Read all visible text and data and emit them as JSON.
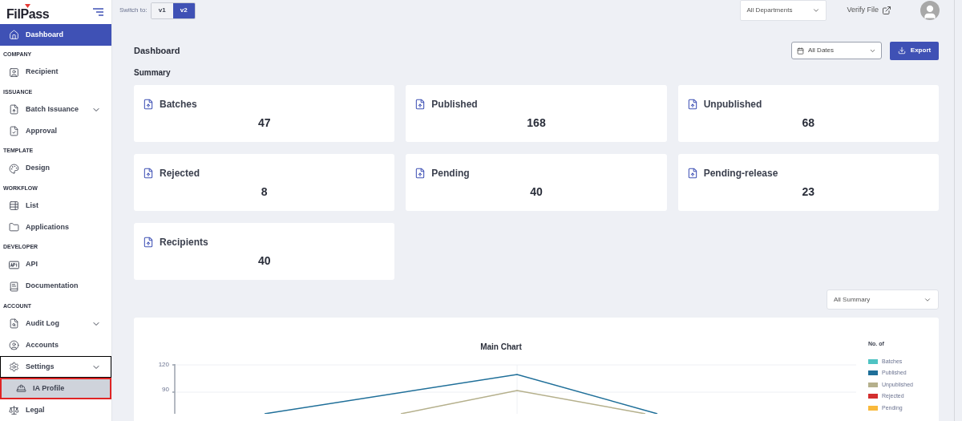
{
  "logo": "FilPass",
  "sidebar": {
    "sections": [
      {
        "items": [
          {
            "label": "Dashboard",
            "selected": true
          }
        ]
      },
      {
        "header": "COMPANY",
        "items": [
          {
            "label": "Recipient",
            "selected": false
          }
        ]
      },
      {
        "header": "ISSUANCE",
        "items": [
          {
            "label": "Batch Issuance",
            "selected": false,
            "expanded": false
          },
          {
            "label": "Approval",
            "selected": false
          }
        ]
      },
      {
        "header": "TEMPLATE",
        "items": [
          {
            "label": "Design",
            "selected": false
          }
        ]
      },
      {
        "header": "WORKFLOW",
        "items": [
          {
            "label": "List",
            "selected": false
          },
          {
            "label": "Applications",
            "selected": false
          }
        ]
      },
      {
        "header": "DEVELOPER",
        "items": [
          {
            "label": "API",
            "selected": false
          },
          {
            "label": "Documentation",
            "selected": false
          }
        ]
      },
      {
        "header": "ACCOUNT",
        "items": [
          {
            "label": "Audit Log",
            "selected": false,
            "expanded": false
          },
          {
            "label": "Accounts",
            "selected": false
          },
          {
            "label": "Settings",
            "selected": false,
            "expanded": true,
            "children": [
              {
                "label": "IA Profile",
                "selected": true
              }
            ]
          },
          {
            "label": "Legal",
            "selected": false
          }
        ]
      }
    ]
  },
  "topbar": {
    "switch_label": "Switch to:",
    "versions": [
      {
        "label": "v1",
        "selected": false
      },
      {
        "label": "v2",
        "selected": true
      }
    ],
    "department": "All Departments",
    "verify": "Verify File"
  },
  "page_title": "Dashboard",
  "date_filter": "All Dates",
  "export": "Export",
  "summary_title": "Summary",
  "cards": [
    {
      "label": "Batches",
      "value": "47"
    },
    {
      "label": "Published",
      "value": "168"
    },
    {
      "label": "Unpublished",
      "value": "68"
    },
    {
      "label": "Rejected",
      "value": "8"
    },
    {
      "label": "Pending",
      "value": "40"
    },
    {
      "label": "Pending-release",
      "value": "23"
    },
    {
      "label": "Recipients",
      "value": "40"
    }
  ],
  "summary_filter": "All Summary",
  "chart": {
    "title": "Main Chart",
    "ytick_labels": [
      "120",
      "90"
    ],
    "legend_title": "No. of",
    "legend": [
      {
        "label": "Batches",
        "color": "#4fc3c3"
      },
      {
        "label": "Published",
        "color": "#1f6f99"
      },
      {
        "label": "Unpublished",
        "color": "#b5b08c"
      },
      {
        "label": "Rejected",
        "color": "#d32f2f"
      },
      {
        "label": "Pending",
        "color": "#f9b93b"
      }
    ]
  }
}
